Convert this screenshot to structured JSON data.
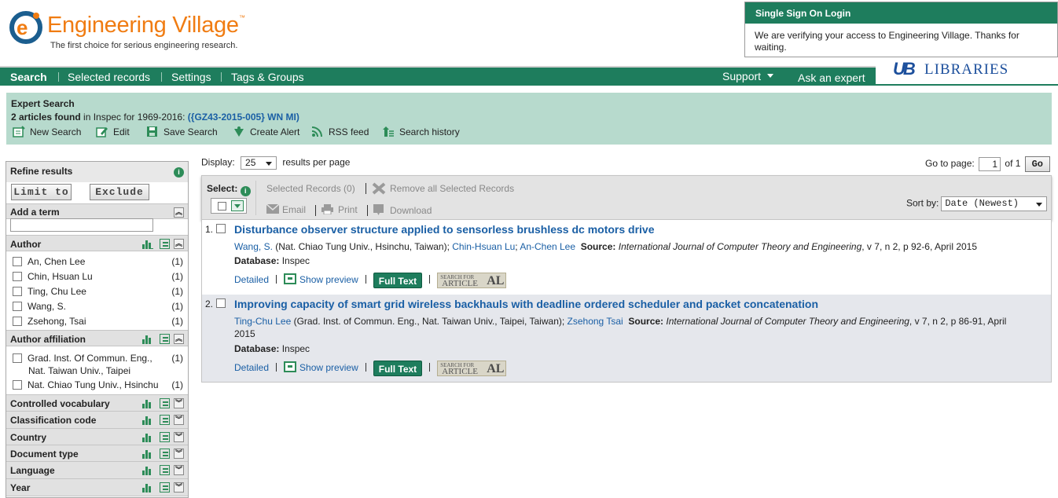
{
  "header": {
    "logo_title": "Engineering Village",
    "logo_tm": "™",
    "tagline": "The first choice for serious engineering research."
  },
  "sso": {
    "title": "Single Sign On Login",
    "message": "We are verifying your access to Engineering Village. Thanks for waiting."
  },
  "nav": {
    "items": [
      "Search",
      "Selected records",
      "Settings",
      "Tags & Groups"
    ],
    "support": "Support",
    "ask_expert": "Ask an expert"
  },
  "library": {
    "mark": "UB",
    "name": "LIBRARIES"
  },
  "expert": {
    "heading": "Expert Search",
    "count_bold": "2 articles found",
    "count_rest": " in Inspec for 1969-2016: ",
    "query": "({GZ43-2015-005} WN MI)",
    "actions": [
      "New Search",
      "Edit",
      "Save Search",
      "Create Alert",
      "RSS feed",
      "Search history"
    ]
  },
  "sidebar": {
    "refine": "Refine results",
    "limit_to": "Limit to",
    "exclude": "Exclude",
    "add_term": "Add a term",
    "author": {
      "title": "Author",
      "items": [
        {
          "label": "An, Chen Lee",
          "count": "(1)"
        },
        {
          "label": "Chin, Hsuan Lu",
          "count": "(1)"
        },
        {
          "label": "Ting, Chu Lee",
          "count": "(1)"
        },
        {
          "label": "Wang, S.",
          "count": "(1)"
        },
        {
          "label": "Zsehong, Tsai",
          "count": "(1)"
        }
      ]
    },
    "affiliation": {
      "title": "Author affiliation",
      "items": [
        {
          "line1": "Grad. Inst. Of Commun. Eng.,",
          "line2": "Nat. Taiwan Univ., Taipei",
          "count": "(1)"
        },
        {
          "line1": "Nat. Chiao Tung Univ., Hsinchu",
          "line2": "",
          "count": "(1)"
        }
      ]
    },
    "facets": [
      "Controlled vocabulary",
      "Classification code",
      "Country",
      "Document type",
      "Language",
      "Year"
    ]
  },
  "results_controls": {
    "display_label": "Display:",
    "display_value": "25",
    "per_page": "results per page",
    "goto_label": "Go to page:",
    "page_value": "1",
    "of_label": "of 1",
    "go": "Go"
  },
  "toolbar": {
    "select": "Select:",
    "selected_records": "Selected Records (0)",
    "remove_all": "Remove all Selected Records",
    "email": "Email",
    "print": "Print",
    "download": "Download",
    "sort_by": "Sort by:",
    "sort_value": "Date (Newest)"
  },
  "records": [
    {
      "num": "1.",
      "title": "Disturbance observer structure applied to sensorless brushless dc motors drive",
      "author1": "Wang, S.",
      "aff1": " (Nat. Chiao Tung Univ., Hsinchu, Taiwan); ",
      "author2": "Chin-Hsuan Lu",
      "sep2": "; ",
      "author3": "An-Chen Lee",
      "source_label": "Source:",
      "journal": "International Journal of Computer Theory and Engineering",
      "details": ", v 7, n 2, p 92-6, April 2015",
      "db_label": "Database:",
      "db_value": " Inspec",
      "detailed": "Detailed",
      "show_preview": "Show preview",
      "full_text": "Full Text",
      "sfa_top": "SEARCH FOR",
      "sfa_mid": "ARTICLE",
      "sfa_right": "AL"
    },
    {
      "num": "2.",
      "title": "Improving capacity of smart grid wireless backhauls with deadline ordered scheduler and packet concatenation",
      "author1": "Ting-Chu Lee",
      "aff1": " (Grad. Inst. of Commun. Eng., Nat. Taiwan Univ., Taipei, Taiwan); ",
      "author2": "Zsehong Tsai",
      "source_label": "Source:",
      "journal": "International Journal of Computer Theory and Engineering",
      "details": ", v 7, n 2, p 86-91, April 2015",
      "db_label": "Database:",
      "db_value": " Inspec",
      "detailed": "Detailed",
      "show_preview": "Show preview",
      "full_text": "Full Text",
      "sfa_top": "SEARCH FOR",
      "sfa_mid": "ARTICLE",
      "sfa_right": "AL"
    }
  ]
}
